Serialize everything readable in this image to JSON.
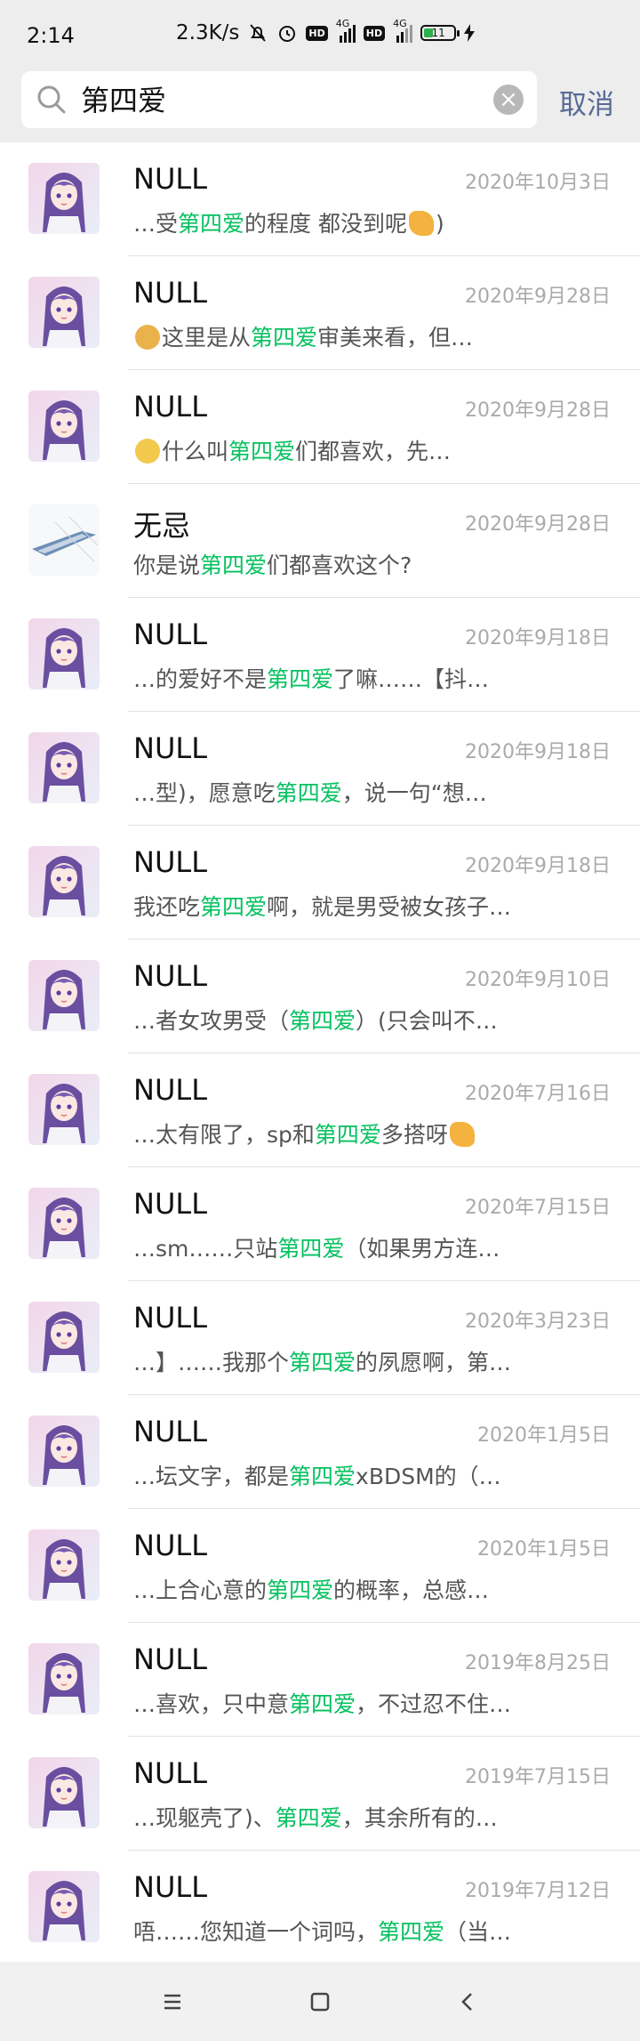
{
  "status_bar": {
    "time": "2:14",
    "speed": "2.3K/s",
    "battery": "11",
    "network_1": "4G",
    "network_2": "4G",
    "hd_1": "HD",
    "hd_2": "HD"
  },
  "search": {
    "query": "第四爱",
    "cancel_label": "取消"
  },
  "colors": {
    "highlight": "#07c160",
    "cancel": "#576b95",
    "date": "#aaaaaa"
  },
  "icons": {
    "search": "search-icon",
    "clear": "clear-icon",
    "menu": "menu-icon",
    "home": "home-icon",
    "back": "back-icon",
    "emoji_handshake": "handshake-emoji",
    "emoji_doge": "doge-emoji",
    "emoji_sad": "sad-face-emoji"
  },
  "results": [
    {
      "name": "NULL",
      "date": "2020年10月3日",
      "avatar": "anime",
      "parts": [
        [
          "…受",
          false
        ],
        [
          "第四爱",
          true
        ],
        [
          "的程度 都没到呢",
          false
        ],
        [
          "[handshake]",
          false
        ],
        [
          ")",
          false
        ]
      ]
    },
    {
      "name": "NULL",
      "date": "2020年9月28日",
      "avatar": "anime",
      "parts": [
        [
          "[doge]",
          false
        ],
        [
          "这里是从",
          false
        ],
        [
          "第四爱",
          true
        ],
        [
          "审美来看，但…",
          false
        ]
      ]
    },
    {
      "name": "NULL",
      "date": "2020年9月28日",
      "avatar": "anime",
      "parts": [
        [
          "[sad]",
          false
        ],
        [
          "什么叫",
          false
        ],
        [
          "第四爱",
          true
        ],
        [
          "们都喜欢，先…",
          false
        ]
      ]
    },
    {
      "name": "无忌",
      "date": "2020年9月28日",
      "avatar": "ship",
      "parts": [
        [
          "你是说",
          false
        ],
        [
          "第四爱",
          true
        ],
        [
          "们都喜欢这个?",
          false
        ]
      ]
    },
    {
      "name": "NULL",
      "date": "2020年9月18日",
      "avatar": "anime",
      "parts": [
        [
          "…的爱好不是",
          false
        ],
        [
          "第四爱",
          true
        ],
        [
          "了嘛……【抖…",
          false
        ]
      ]
    },
    {
      "name": "NULL",
      "date": "2020年9月18日",
      "avatar": "anime",
      "parts": [
        [
          "…型)，愿意吃",
          false
        ],
        [
          "第四爱",
          true
        ],
        [
          "，说一句“想…",
          false
        ]
      ]
    },
    {
      "name": "NULL",
      "date": "2020年9月18日",
      "avatar": "anime",
      "parts": [
        [
          "我还吃",
          false
        ],
        [
          "第四爱",
          true
        ],
        [
          "啊，就是男受被女孩子…",
          false
        ]
      ]
    },
    {
      "name": "NULL",
      "date": "2020年9月10日",
      "avatar": "anime",
      "parts": [
        [
          "…者女攻男受（",
          false
        ],
        [
          "第四爱",
          true
        ],
        [
          "）(只会叫不…",
          false
        ]
      ]
    },
    {
      "name": "NULL",
      "date": "2020年7月16日",
      "avatar": "anime",
      "parts": [
        [
          "…太有限了，sp和",
          false
        ],
        [
          "第四爱",
          true
        ],
        [
          "多搭呀",
          false
        ],
        [
          "[handshake]",
          false
        ]
      ]
    },
    {
      "name": "NULL",
      "date": "2020年7月15日",
      "avatar": "anime",
      "parts": [
        [
          "…sm……只站",
          false
        ],
        [
          "第四爱",
          true
        ],
        [
          "（如果男方连…",
          false
        ]
      ]
    },
    {
      "name": "NULL",
      "date": "2020年3月23日",
      "avatar": "anime",
      "parts": [
        [
          "…】……我那个",
          false
        ],
        [
          "第四爱",
          true
        ],
        [
          "的夙愿啊，第…",
          false
        ]
      ]
    },
    {
      "name": "NULL",
      "date": "2020年1月5日",
      "avatar": "anime",
      "parts": [
        [
          "…坛文字，都是",
          false
        ],
        [
          "第四爱",
          true
        ],
        [
          "xBDSM的（…",
          false
        ]
      ]
    },
    {
      "name": "NULL",
      "date": "2020年1月5日",
      "avatar": "anime",
      "parts": [
        [
          "…上合心意的",
          false
        ],
        [
          "第四爱",
          true
        ],
        [
          "的概率，总感…",
          false
        ]
      ]
    },
    {
      "name": "NULL",
      "date": "2019年8月25日",
      "avatar": "anime",
      "parts": [
        [
          "…喜欢，只中意",
          false
        ],
        [
          "第四爱",
          true
        ],
        [
          "，不过忍不住…",
          false
        ]
      ]
    },
    {
      "name": "NULL",
      "date": "2019年7月15日",
      "avatar": "anime",
      "parts": [
        [
          "…现躯壳了)、",
          false
        ],
        [
          "第四爱",
          true
        ],
        [
          "，其余所有的…",
          false
        ]
      ]
    },
    {
      "name": "NULL",
      "date": "2019年7月12日",
      "avatar": "anime",
      "parts": [
        [
          "唔……您知道一个词吗，",
          false
        ],
        [
          "第四爱",
          true
        ],
        [
          "（当…",
          false
        ]
      ]
    }
  ]
}
